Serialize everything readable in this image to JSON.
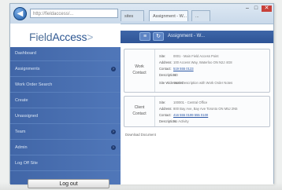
{
  "browser": {
    "back_symbol": "◀",
    "address": "http://fieldaccess/...",
    "tabs": [
      "sites",
      "Assignment - W...",
      "..."
    ],
    "controls": [
      "–",
      "□",
      "✕"
    ]
  },
  "app": {
    "logo": {
      "part1": "Field",
      "part2": "Access",
      "chevron": ">"
    },
    "header_title": "Assignment - W..."
  },
  "sidebar": {
    "items": [
      {
        "label": "Dashboard",
        "arrow": false
      },
      {
        "label": "Assignments",
        "arrow": true
      },
      {
        "label": "Work Order Search",
        "arrow": false
      },
      {
        "label": "Create",
        "arrow": false
      },
      {
        "label": "Unassigned",
        "arrow": false
      },
      {
        "label": "Team",
        "arrow": true
      },
      {
        "label": "Admin",
        "arrow": true
      },
      {
        "label": "Log Off Site",
        "arrow": false
      }
    ],
    "logout_label": "Log out"
  },
  "cards": [
    {
      "name_lines": [
        "Work",
        "Contact"
      ],
      "rows": [
        {
          "label": "Site:",
          "value": "0001 - Main Field Access Point",
          "link": false
        },
        {
          "label": "Address:",
          "value": "100 Access Way, Waterloo ON N2J 4G8",
          "link": false
        },
        {
          "label": "Contact:",
          "value": "519 555 0123",
          "link": true
        },
        {
          "label": "Description:",
          "value": "ND",
          "link": false
        },
        {
          "label": "Site Wide Notes:",
          "value": "Work Description with Work Order Notes",
          "link": false
        }
      ]
    },
    {
      "name_lines": [
        "Client",
        "Contact"
      ],
      "rows": [
        {
          "label": "Site:",
          "value": "100001 - Central Office",
          "link": false
        },
        {
          "label": "Address:",
          "value": "800 Bay Ave, Bay Ave Toronto ON M5J 2N5",
          "link": false
        },
        {
          "label": "Contact:",
          "value": "416 555 0199 555 0100",
          "link": true
        },
        {
          "label": "Description:",
          "value": "No Activity",
          "link": false
        }
      ]
    }
  ],
  "footer_link": "Download Document"
}
